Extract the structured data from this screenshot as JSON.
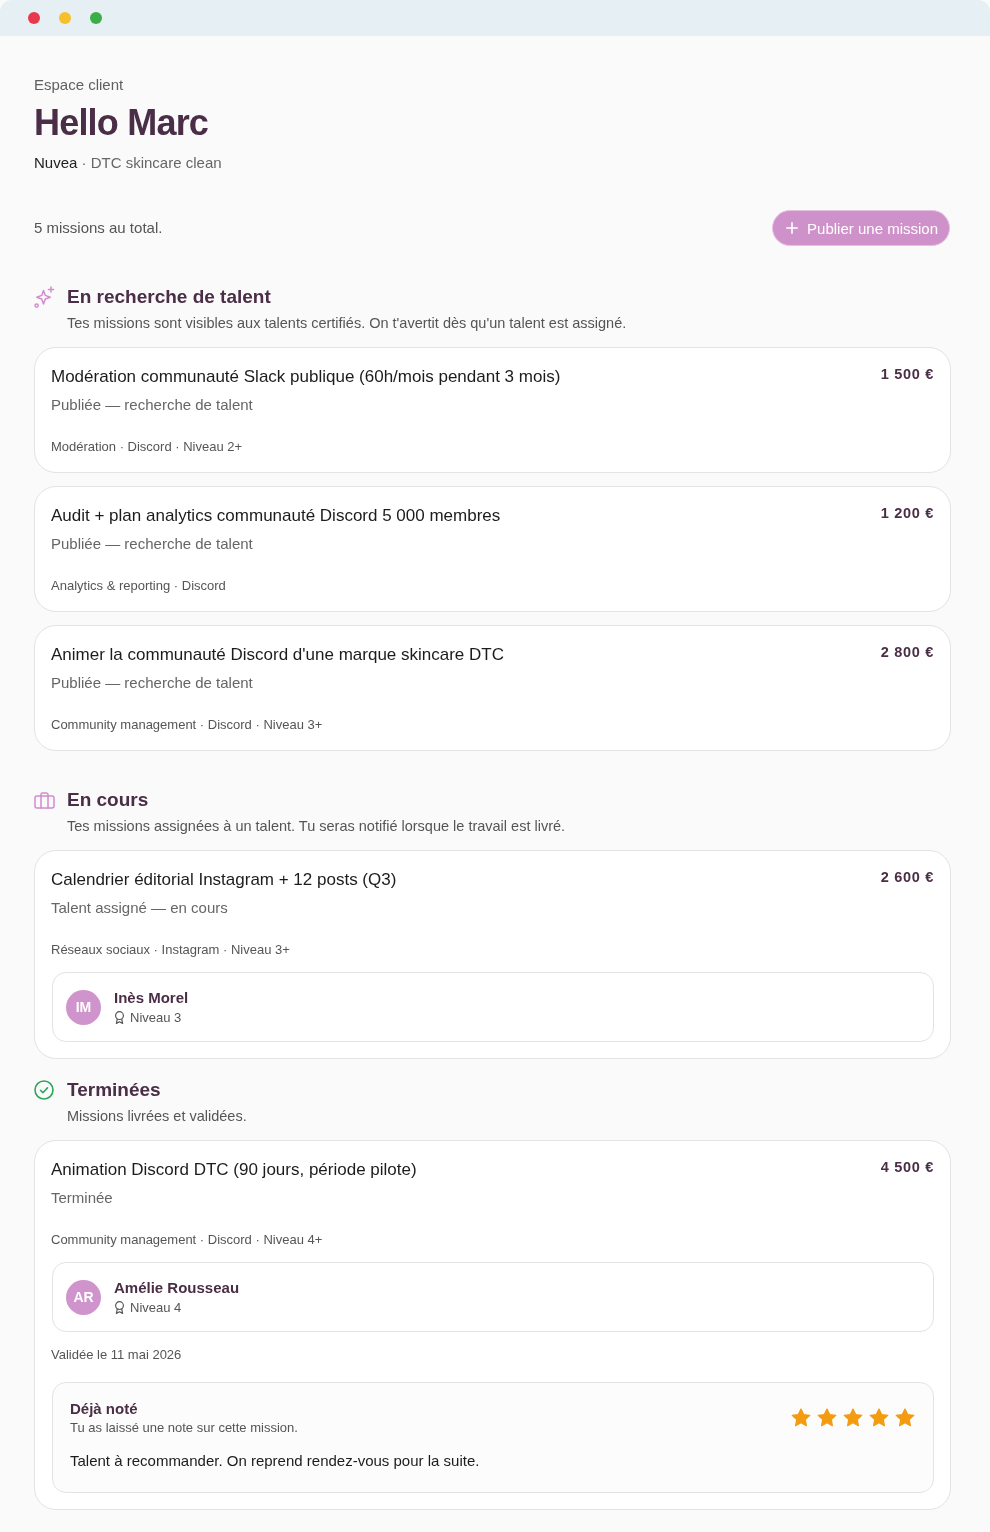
{
  "window": {
    "controls": [
      {
        "color": "#e8374f"
      },
      {
        "color": "#f6c02d"
      },
      {
        "color": "#3dad49"
      }
    ]
  },
  "header": {
    "eyebrow": "Espace client",
    "greeting": "Hello Marc",
    "subtitle": "**Nuvea** · DTC skincare clean"
  },
  "summary": {
    "count": "5 missions au total.",
    "action": {
      "label": "Publier une mission"
    }
  },
  "sections": [
    {
      "kind": "open",
      "title": "En recherche de talent",
      "description": "Tes missions sont visibles aux talents certifiés. On t'avertit dès qu'un talent est assigné.",
      "missions": [
        {
          "title": "Modération communauté Slack publique (60h/mois pendant 3 mois)",
          "price": "1 500 €",
          "status": "Publiée — recherche de talent",
          "tags": "Modération · Discord · Niveau 2+"
        },
        {
          "title": "Audit + plan analytics communauté Discord 5 000 membres",
          "price": "1 200 €",
          "status": "Publiée — recherche de talent",
          "tags": "Analytics & reporting · Discord"
        },
        {
          "title": "Animer la communauté Discord d'une marque skincare DTC",
          "price": "2 800 €",
          "status": "Publiée — recherche de talent",
          "tags": "Community management · Discord · Niveau 3+"
        }
      ]
    },
    {
      "kind": "in_progress",
      "title": "En cours",
      "description": "Tes missions assignées à un talent. Tu seras notifié lorsque le travail est livré.",
      "missions": [
        {
          "title": "Calendrier éditorial Instagram + 12 posts (Q3)",
          "price": "2 600 €",
          "status": "Talent assigné — en cours",
          "tags": "Réseaux sociaux · Instagram · Niveau 3+",
          "talent": {
            "initials": "IM",
            "name": "Inès Morel",
            "rank": "Niveau 3"
          }
        }
      ]
    },
    {
      "kind": "done",
      "title": "Terminées",
      "description": "Missions livrées et validées.",
      "missions": [
        {
          "title": "Animation Discord DTC (90 jours, période pilote)",
          "price": "4 500 €",
          "status": "Terminée",
          "tags": "Community management · Discord · Niveau 4+",
          "talent": {
            "initials": "AR",
            "name": "Amélie Rousseau",
            "rank": "Niveau 4"
          },
          "validated": "Validée le 11 mai 2026",
          "rating": {
            "title": "Déjà noté",
            "note": "Tu as laissé une note sur cette mission.",
            "stars": 5,
            "comment": "Talent à recommander. On reprend rendez-vous pour la suite."
          }
        }
      ]
    }
  ]
}
